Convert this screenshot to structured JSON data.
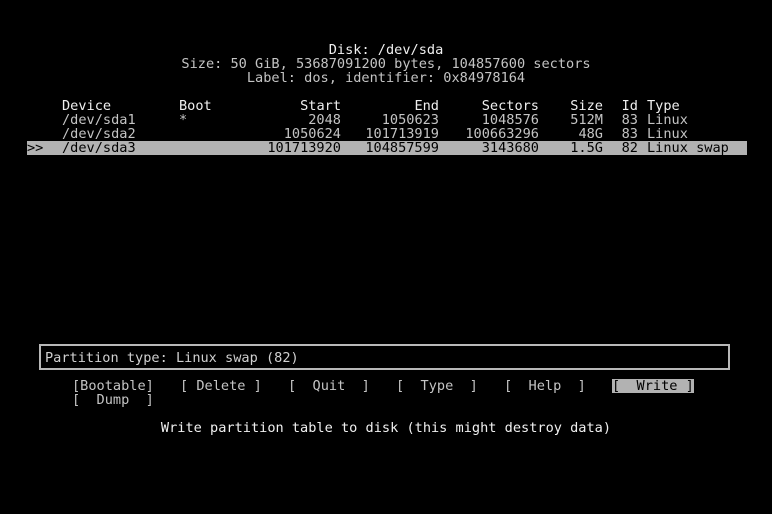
{
  "disk": {
    "title": "Disk: /dev/sda",
    "size_line": "Size: 50 GiB, 53687091200 bytes, 104857600 sectors",
    "label_line": "Label: dos, identifier: 0x84978164"
  },
  "table": {
    "headers": {
      "device": "Device",
      "boot": "Boot",
      "start": "Start",
      "end": "End",
      "sectors": "Sectors",
      "size": "Size",
      "id": "Id",
      "type": "Type"
    },
    "rows": [
      {
        "marker": "",
        "device": "/dev/sda1",
        "boot": "*",
        "start": "2048",
        "end": "1050623",
        "sectors": "1048576",
        "size": "512M",
        "id": "83",
        "type": "Linux"
      },
      {
        "marker": "",
        "device": "/dev/sda2",
        "boot": "",
        "start": "1050624",
        "end": "101713919",
        "sectors": "100663296",
        "size": "48G",
        "id": "83",
        "type": "Linux"
      },
      {
        "marker": ">>",
        "device": "/dev/sda3",
        "boot": "",
        "start": "101713920",
        "end": "104857599",
        "sectors": "3143680",
        "size": "1.5G",
        "id": "82",
        "type": "Linux swap"
      }
    ],
    "selected_index": 2
  },
  "info": {
    "text": "Partition type: Linux swap (82)"
  },
  "menu": {
    "items": [
      {
        "label": "[Bootable]"
      },
      {
        "label": "[ Delete ]"
      },
      {
        "label": "[  Quit  ]"
      },
      {
        "label": "[  Type  ]"
      },
      {
        "label": "[  Help  ]"
      },
      {
        "label": "[  Write ]"
      },
      {
        "label": "[  Dump  ]"
      }
    ],
    "active_index": 5
  },
  "status": {
    "text": "Write partition table to disk (this might destroy data)"
  },
  "colors": {
    "background": "#000000",
    "text": "#c4c4c4",
    "highlight_bg": "#b2b2b2",
    "highlight_fg": "#000000"
  }
}
